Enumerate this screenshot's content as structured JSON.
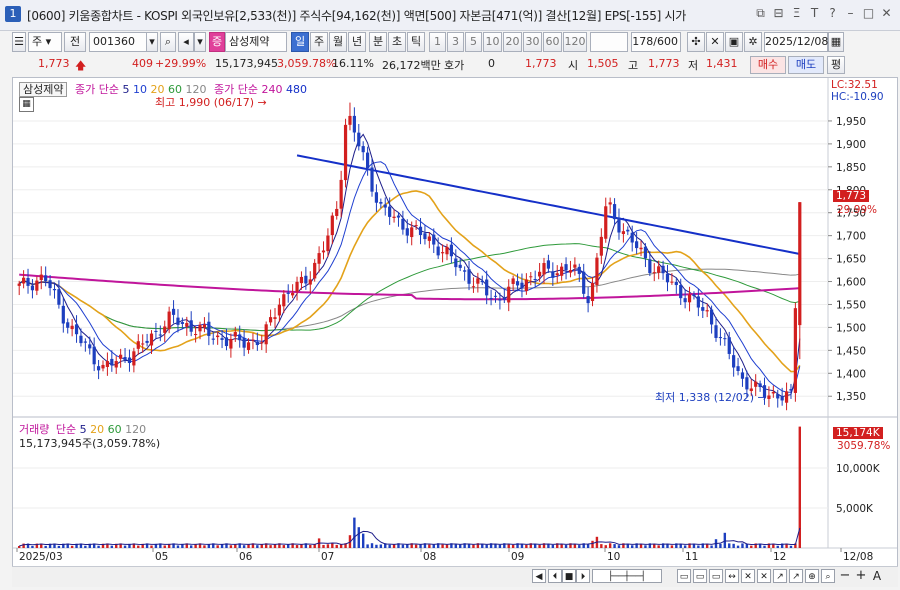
{
  "window": {
    "number": "1",
    "title": "[0600] 키움종합차트 - KOSPI 외국인보유[2,533(천)] 주식수[94,162(천)] 액면[500] 자본금[471(억)] 결산[12월] EPS[-155] 시가",
    "icons": [
      "restore-icon",
      "link-icon",
      "letter-icon",
      "translate-icon",
      "help-icon",
      "minimize-icon",
      "maximize-icon",
      "close-icon"
    ]
  },
  "toolbar": {
    "market": "주",
    "prev": "전",
    "code": "001360",
    "name_badge": "증",
    "name": "삼성제약",
    "periods": [
      "일",
      "주",
      "월",
      "년",
      "분",
      "초",
      "틱"
    ],
    "active_period": "일",
    "intervals": [
      "1",
      "3",
      "5",
      "10",
      "20",
      "30",
      "60",
      "120"
    ],
    "count": "178",
    "count_total": "/600",
    "date": "2025/12/08"
  },
  "quote": {
    "price": "1,773",
    "change": "409",
    "change_pct": "+29.99%",
    "volume": "15,173,945",
    "volume_pct": "3,059.78%",
    "turnover": "16.11%",
    "amount": "26,172백만",
    "hoga_label": "호가",
    "hoga_value": "0",
    "hoga_price": "1,773",
    "open_label": "시",
    "open": "1,505",
    "high_label": "고",
    "high": "1,773",
    "low_label": "저",
    "low": "1,431",
    "buy": "매수",
    "sell": "매도",
    "eval": "평"
  },
  "price_legend": {
    "name": "삼성제약",
    "ma_label": "종가 단순",
    "ma_periods": [
      "5",
      "10",
      "20",
      "60",
      "120"
    ],
    "ma2_label": "종가 단순",
    "ma2_periods": [
      "240",
      "480"
    ],
    "lc": "LC:32.51",
    "hc": "HC:-10.90"
  },
  "volume_legend": {
    "label": "거래량",
    "ma_label": "단순",
    "ma_periods": [
      "5",
      "20",
      "60",
      "120"
    ],
    "value": "15,173,945주(3,059.78%)"
  },
  "annotations": {
    "high": "최고 1,990 (06/17)",
    "low": "최저 1,338 (12/02)",
    "last_price": "1,773",
    "last_pct": "29.99%",
    "last_volume": "15,174K",
    "last_volume_pct": "3059.78%"
  },
  "colors": {
    "up": "#d21f1f",
    "down": "#1d3fbf",
    "ma5": "#1d1d8a",
    "ma10": "#1f3fd0",
    "ma20": "#e3a21a",
    "ma60": "#2e9a3a",
    "ma120": "#888888",
    "ma240": "#c0159b",
    "ma480": "#1530c8"
  },
  "chart_data": {
    "type": "candlestick",
    "y_ticks": [
      1350,
      1400,
      1450,
      1500,
      1550,
      1600,
      1650,
      1700,
      1750,
      1800,
      1850,
      1900,
      1950
    ],
    "y_range": [
      1320,
      2000
    ],
    "x_labels": [
      "2025/03",
      "05",
      "06",
      "07",
      "08",
      "09",
      "10",
      "11",
      "12",
      "12/08"
    ],
    "volume_ticks": [
      "5,000K",
      "10,000K"
    ],
    "high": {
      "value": 1990,
      "date": "06/17"
    },
    "low": {
      "value": 1338,
      "date": "12/02"
    },
    "last": {
      "close": 1773,
      "open": 1505,
      "high": 1773,
      "low": 1431,
      "volume": 15173945
    }
  }
}
